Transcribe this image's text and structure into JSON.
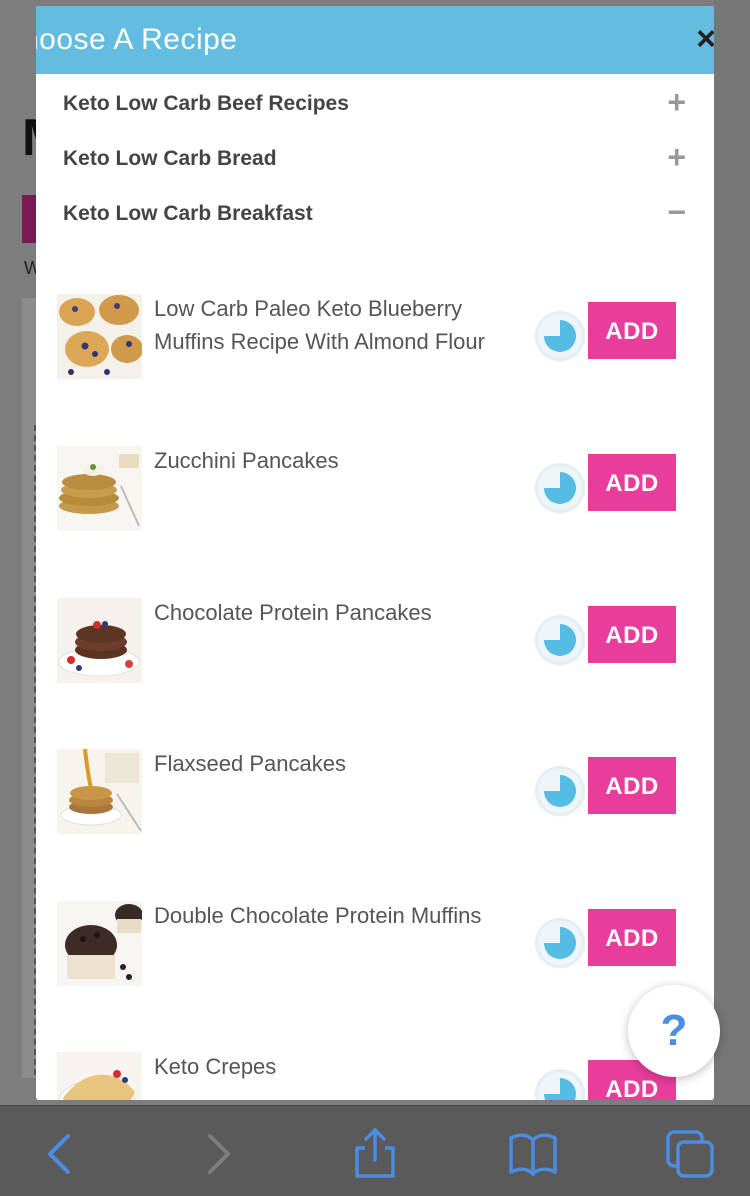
{
  "modal": {
    "title": "hoose A Recipe",
    "close_label": "×"
  },
  "categories": [
    {
      "label": "Keto Low Carb Beef Recipes",
      "toggle": "+"
    },
    {
      "label": "Keto Low Carb Bread",
      "toggle": "+"
    },
    {
      "label": "Keto Low Carb Breakfast",
      "toggle": "−"
    }
  ],
  "recipes": [
    {
      "name": "Low Carb Paleo Keto Blueberry Muffins Recipe With Almond Flour",
      "add_label": "ADD",
      "timer_fill": 0.75
    },
    {
      "name": "Zucchini Pancakes",
      "add_label": "ADD",
      "timer_fill": 0.75
    },
    {
      "name": "Chocolate Protein Pancakes",
      "add_label": "ADD",
      "timer_fill": 0.75
    },
    {
      "name": "Flaxseed Pancakes",
      "add_label": "ADD",
      "timer_fill": 0.75
    },
    {
      "name": "Double Chocolate Protein Muffins",
      "add_label": "ADD",
      "timer_fill": 0.75
    },
    {
      "name": "Keto Crepes",
      "add_label": "ADD",
      "timer_fill": 0.75
    }
  ],
  "help_label": "?",
  "colors": {
    "header": "#64bde0",
    "add_button": "#e93d9c",
    "timer": "#55bde3",
    "toolbar_icons": "#4a8de2"
  },
  "toolbar": {
    "icons": [
      "back-icon",
      "forward-icon",
      "share-icon",
      "bookmarks-icon",
      "tabs-icon"
    ]
  }
}
